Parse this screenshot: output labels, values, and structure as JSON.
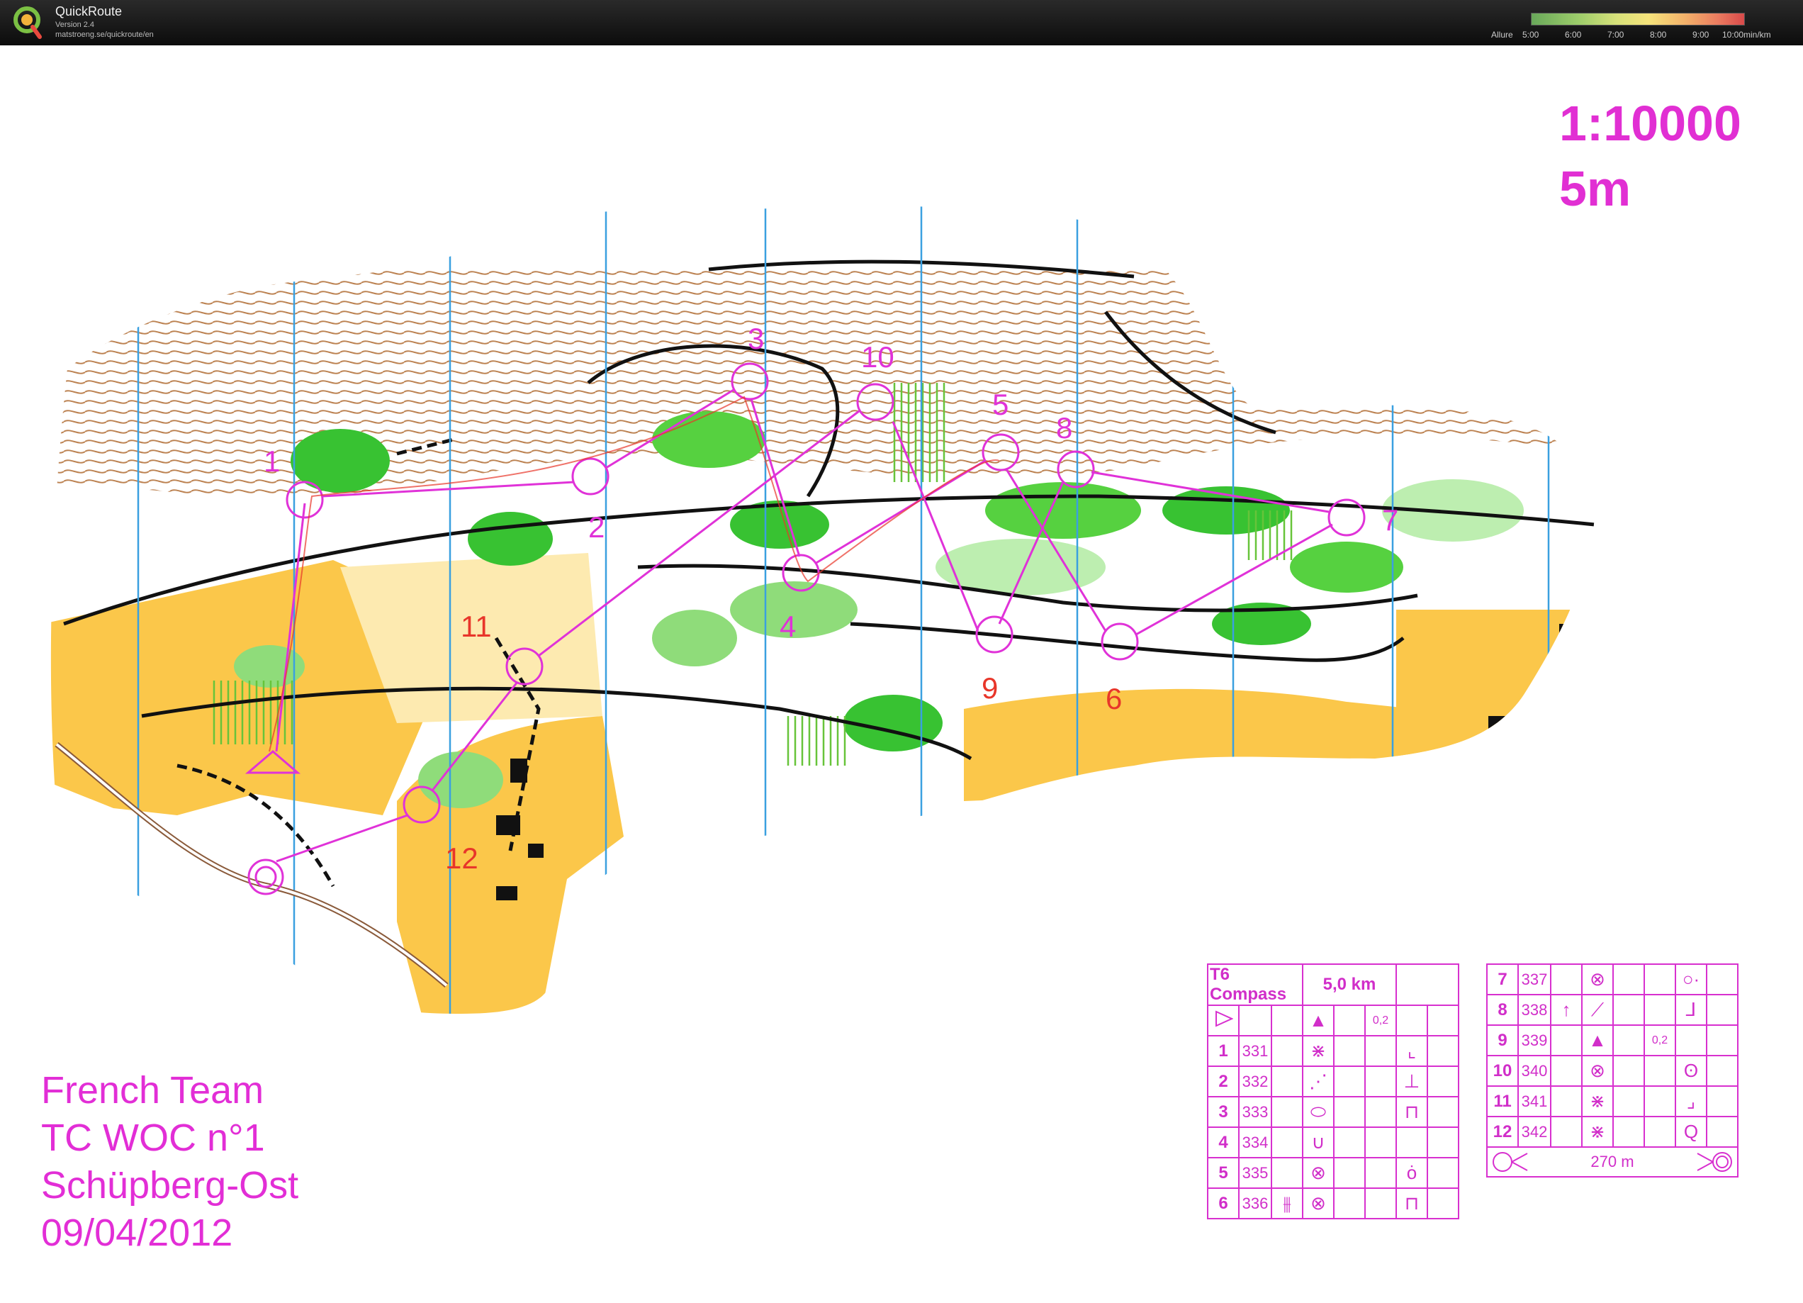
{
  "app": {
    "title": "QuickRoute",
    "version": "Version 2.4",
    "url": "matstroeng.se/quickroute/en"
  },
  "pace_legend": {
    "label": "Allure",
    "ticks": [
      "5:00",
      "6:00",
      "7:00",
      "8:00",
      "9:00",
      "10:00"
    ],
    "unit": "min/km"
  },
  "map": {
    "scale": "1:10000",
    "contour": "5m",
    "info": [
      "French Team",
      "TC WOC n°1",
      "Schüpberg-Ost",
      "09/04/2012"
    ],
    "control_labels": [
      "1",
      "2",
      "3",
      "4",
      "5",
      "6",
      "7",
      "8",
      "9",
      "10",
      "11",
      "12"
    ],
    "colors": {
      "course": "#e032d8",
      "gps_route": "#e8362a",
      "open_land": "#fbc74a",
      "green": "#38c232",
      "north_lines": "#3aa0e0",
      "contours": "#b5743e"
    }
  },
  "course": {
    "name": "T6 Compass",
    "length": "5,0 km",
    "start_distance": "0,2",
    "finish_distance": "270 m",
    "controls": [
      {
        "n": "1",
        "code": "331"
      },
      {
        "n": "2",
        "code": "332"
      },
      {
        "n": "3",
        "code": "333"
      },
      {
        "n": "4",
        "code": "334"
      },
      {
        "n": "5",
        "code": "335"
      },
      {
        "n": "6",
        "code": "336"
      },
      {
        "n": "7",
        "code": "337"
      },
      {
        "n": "8",
        "code": "338"
      },
      {
        "n": "9",
        "code": "339",
        "dist": "0,2"
      },
      {
        "n": "10",
        "code": "340"
      },
      {
        "n": "11",
        "code": "341"
      },
      {
        "n": "12",
        "code": "342"
      }
    ]
  }
}
